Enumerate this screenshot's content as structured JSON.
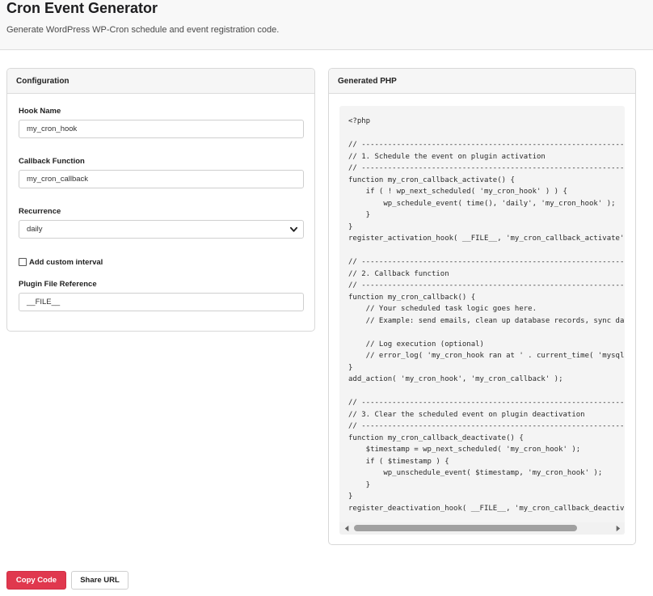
{
  "header": {
    "title": "Cron Event Generator",
    "subtitle": "Generate WordPress WP-Cron schedule and event registration code."
  },
  "config": {
    "heading": "Configuration",
    "hook_name": {
      "label": "Hook Name",
      "value": "my_cron_hook"
    },
    "callback_function": {
      "label": "Callback Function",
      "value": "my_cron_callback"
    },
    "recurrence": {
      "label": "Recurrence",
      "value": "daily"
    },
    "custom_interval": {
      "label": "Add custom interval",
      "checked": false
    },
    "plugin_file": {
      "label": "Plugin File Reference",
      "value": "__FILE__"
    }
  },
  "output": {
    "heading": "Generated PHP",
    "code": "<?php\n\n// ----------------------------------------------------------------\n// 1. Schedule the event on plugin activation\n// ----------------------------------------------------------------\nfunction my_cron_callback_activate() {\n    if ( ! wp_next_scheduled( 'my_cron_hook' ) ) {\n        wp_schedule_event( time(), 'daily', 'my_cron_hook' );\n    }\n}\nregister_activation_hook( __FILE__, 'my_cron_callback_activate' );\n\n// ----------------------------------------------------------------\n// 2. Callback function\n// ----------------------------------------------------------------\nfunction my_cron_callback() {\n    // Your scheduled task logic goes here.\n    // Example: send emails, clean up database records, sync data, etc.\n\n    // Log execution (optional)\n    // error_log( 'my_cron_hook ran at ' . current_time( 'mysql' ) );\n}\nadd_action( 'my_cron_hook', 'my_cron_callback' );\n\n// ----------------------------------------------------------------\n// 3. Clear the scheduled event on plugin deactivation\n// ----------------------------------------------------------------\nfunction my_cron_callback_deactivate() {\n    $timestamp = wp_next_scheduled( 'my_cron_hook' );\n    if ( $timestamp ) {\n        wp_unschedule_event( $timestamp, 'my_cron_hook' );\n    }\n}\nregister_deactivation_hook( __FILE__, 'my_cron_callback_deactivate' );"
  },
  "actions": {
    "copy_label": "Copy Code",
    "share_label": "Share URL"
  },
  "icons": {
    "select": "chevron-down-icon",
    "scroll_left": "triangle-left-icon",
    "scroll_right": "triangle-right-icon"
  },
  "colors": {
    "accent": "#e0384e",
    "header_bg": "#f8f8f8",
    "code_bg": "#f4f4f4"
  }
}
